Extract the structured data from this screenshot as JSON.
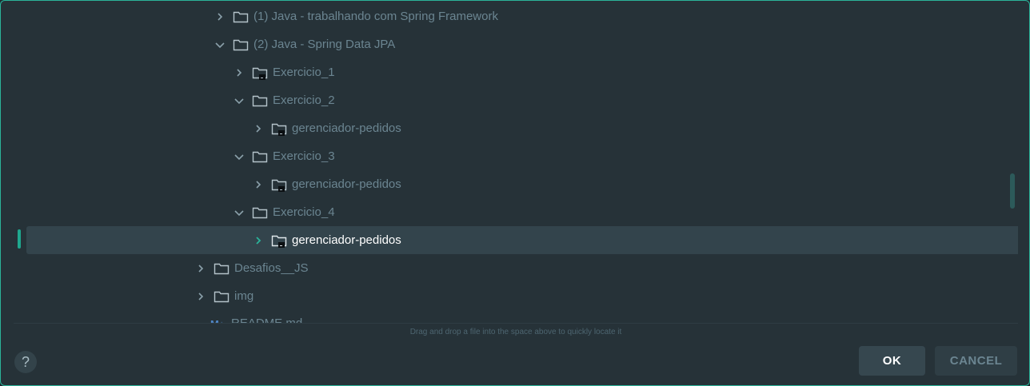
{
  "tree": {
    "items": [
      {
        "label": "(1) Java - trabalhando com Spring Framework",
        "expanded": false,
        "icon": "folder-icon"
      },
      {
        "label": "(2) Java - Spring Data JPA",
        "expanded": true,
        "icon": "folder-icon"
      },
      {
        "label": "Exercicio_1",
        "expanded": false,
        "icon": "module-folder-icon"
      },
      {
        "label": "Exercicio_2",
        "expanded": true,
        "icon": "folder-icon"
      },
      {
        "label": "gerenciador-pedidos",
        "expanded": false,
        "icon": "module-folder-icon"
      },
      {
        "label": "Exercicio_3",
        "expanded": true,
        "icon": "folder-icon"
      },
      {
        "label": "gerenciador-pedidos",
        "expanded": false,
        "icon": "module-folder-icon"
      },
      {
        "label": "Exercicio_4",
        "expanded": true,
        "icon": "folder-icon"
      },
      {
        "label": "gerenciador-pedidos",
        "expanded": false,
        "icon": "module-folder-icon",
        "selected": true
      },
      {
        "label": "Desafios__JS",
        "expanded": false,
        "icon": "folder-icon"
      },
      {
        "label": "img",
        "expanded": false,
        "icon": "folder-icon"
      },
      {
        "label": "README.md",
        "icon": "markdown-file-icon"
      }
    ]
  },
  "hint": "Drag and drop a file into the space above to quickly locate it",
  "buttons": {
    "help": "?",
    "ok": "OK",
    "cancel": "CANCEL"
  },
  "colors": {
    "accent": "#2bb39a",
    "background": "#263238",
    "text_muted": "#6b8591",
    "selected_bg": "#33444c"
  }
}
